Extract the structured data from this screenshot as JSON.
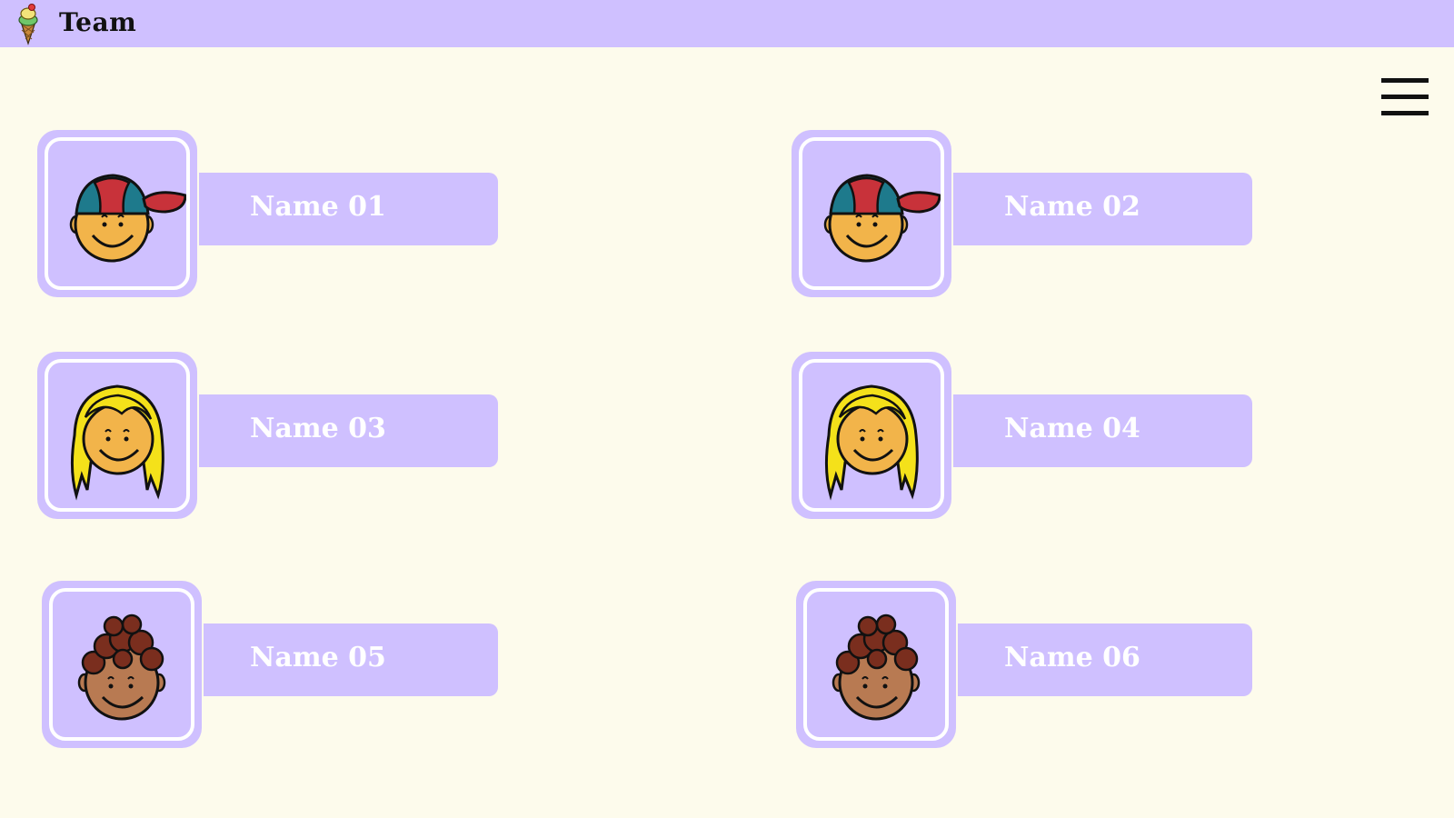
{
  "header": {
    "title": "Team",
    "logo_icon": "ice-cream-cone-icon",
    "background": "#cfc0ff"
  },
  "menu": {
    "icon": "hamburger-menu-icon"
  },
  "members": [
    {
      "name": "Name 01",
      "avatar": "boy-cap-avatar-icon"
    },
    {
      "name": "Name 02",
      "avatar": "boy-cap-avatar-icon"
    },
    {
      "name": "Name 03",
      "avatar": "blonde-girl-avatar-icon"
    },
    {
      "name": "Name 04",
      "avatar": "blonde-girl-avatar-icon"
    },
    {
      "name": "Name 05",
      "avatar": "curly-hair-avatar-icon"
    },
    {
      "name": "Name 06",
      "avatar": "curly-hair-avatar-icon"
    }
  ],
  "colors": {
    "page_background": "#fdfbec",
    "accent": "#cfc0ff",
    "name_text": "#ffffff"
  }
}
